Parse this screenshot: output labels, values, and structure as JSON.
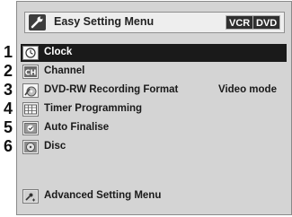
{
  "title": "Easy Setting Menu",
  "badges": [
    "VCR",
    "DVD"
  ],
  "numbers": [
    "1",
    "2",
    "3",
    "4",
    "5",
    "6"
  ],
  "menu_items": [
    {
      "label": "Clock",
      "value": "",
      "icon": "clock-icon",
      "selected": true
    },
    {
      "label": "Channel",
      "value": "",
      "icon": "channel-icon",
      "selected": false
    },
    {
      "label": "DVD-RW Recording Format",
      "value": "Video mode",
      "icon": "dvd-rw-format-icon",
      "selected": false
    },
    {
      "label": "Timer Programming",
      "value": "",
      "icon": "timer-programming-icon",
      "selected": false
    },
    {
      "label": "Auto Finalise",
      "value": "",
      "icon": "auto-finalise-icon",
      "selected": false
    },
    {
      "label": "Disc",
      "value": "",
      "icon": "disc-icon",
      "selected": false
    }
  ],
  "advanced": {
    "label": "Advanced Setting Menu",
    "icon": "advanced-settings-icon"
  },
  "colors": {
    "selected_row": "#1a1a1a",
    "panel_bg": "#d4d4d4"
  }
}
